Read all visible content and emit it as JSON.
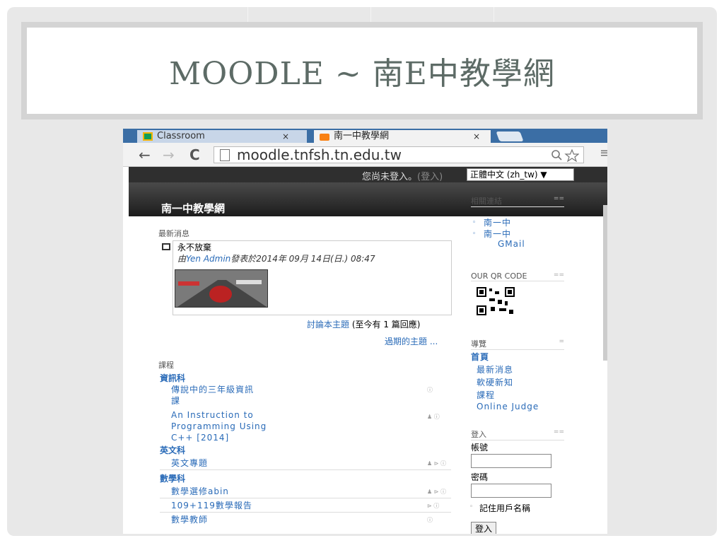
{
  "slide": {
    "title": "MOODLE ~ 南E中教學網"
  },
  "browser": {
    "tabs": [
      {
        "label": "Classroom"
      },
      {
        "label": "南一中教學網"
      }
    ],
    "tab_close": "×",
    "nav": {
      "back": "←",
      "forward": "→",
      "reload": "C"
    },
    "url": "moodle.tnfsh.tn.edu.tw",
    "menu": "≡"
  },
  "moodle": {
    "login_status": "您尚未登入。",
    "login_paren_open": "(",
    "login_link": "登入",
    "login_paren_close": ")",
    "language": "正體中文 (zh_tw) ▼",
    "site_name": "南一中教學網",
    "news": {
      "heading": "最新消息",
      "post_title": "永不放棄",
      "author_prefix": "由",
      "author": "Yen Admin",
      "posted": "發表於2014年 09月 14日(日.) 08:47",
      "discuss_link": "討論本主題",
      "replies": "(至今有 1 篇回應)",
      "older": "過期的主題 ..."
    },
    "courses": {
      "heading": "課程",
      "categories": [
        {
          "name": "資訊科",
          "items": [
            "傳說中的三年級資訊",
            "課",
            "An Instruction to",
            "Programming Using",
            "C++ [2014]"
          ]
        },
        {
          "name": "英文科",
          "items": [
            "英文專題"
          ]
        },
        {
          "name": "數學科",
          "items": [
            "數學選修abin",
            "109+119數學報告",
            "數學教師"
          ]
        }
      ]
    },
    "blocks": {
      "links": {
        "title": "相關連結",
        "toggle": "==",
        "items": [
          "南一中",
          "南一中",
          "GMail"
        ]
      },
      "qr": {
        "title": "OUR QR CODE",
        "toggle": "=="
      },
      "nav": {
        "title": "導覽",
        "toggle": "=",
        "home": "首頁",
        "items": [
          "最新消息",
          "軟硬新知",
          "課程",
          "Online Judge"
        ]
      },
      "login": {
        "title": "登入",
        "toggle": "==",
        "username_label": "帳號",
        "password_label": "密碼",
        "remember": "記住用戶名稱",
        "button": "登入"
      }
    }
  },
  "colors": {
    "link": "#2a6bb8",
    "tab_strip": "#3b6ea5",
    "slide_title": "#5d6b66"
  }
}
